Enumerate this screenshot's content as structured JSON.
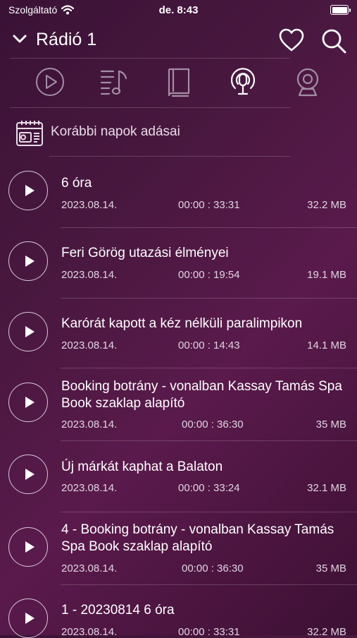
{
  "status": {
    "carrier": "Szolgáltató",
    "time": "de. 8:43"
  },
  "header": {
    "title": "Rádió 1"
  },
  "tabs": [
    "play-icon",
    "music-list-icon",
    "book-icon",
    "podcast-icon",
    "webcam-icon"
  ],
  "archive": {
    "label": "Korábbi napok adásai"
  },
  "episodes": [
    {
      "title": "6 óra",
      "date": "2023.08.14.",
      "duration": "00:00 : 33:31",
      "size": "32.2 MB"
    },
    {
      "title": "Feri Görög utazási élményei",
      "date": "2023.08.14.",
      "duration": "00:00 : 19:54",
      "size": "19.1 MB"
    },
    {
      "title": "Karórát kapott a kéz nélküli paralimpikon",
      "date": "2023.08.14.",
      "duration": "00:00 : 14:43",
      "size": "14.1 MB"
    },
    {
      "title": "Booking botrány - vonalban Kassay Tamás Spa Book szaklap alapító",
      "date": "2023.08.14.",
      "duration": "00:00 : 36:30",
      "size": "35 MB"
    },
    {
      "title": "Új márkát kaphat a Balaton",
      "date": "2023.08.14.",
      "duration": "00:00 : 33:24",
      "size": "32.1 MB"
    },
    {
      "title": "4 - Booking botrány - vonalban Kassay Tamás Spa Book szaklap alapító",
      "date": "2023.08.14.",
      "duration": "00:00 : 36:30",
      "size": "35 MB"
    },
    {
      "title": "1 - 20230814 6 óra",
      "date": "2023.08.14.",
      "duration": "00:00 : 33:31",
      "size": "32.2 MB"
    }
  ]
}
